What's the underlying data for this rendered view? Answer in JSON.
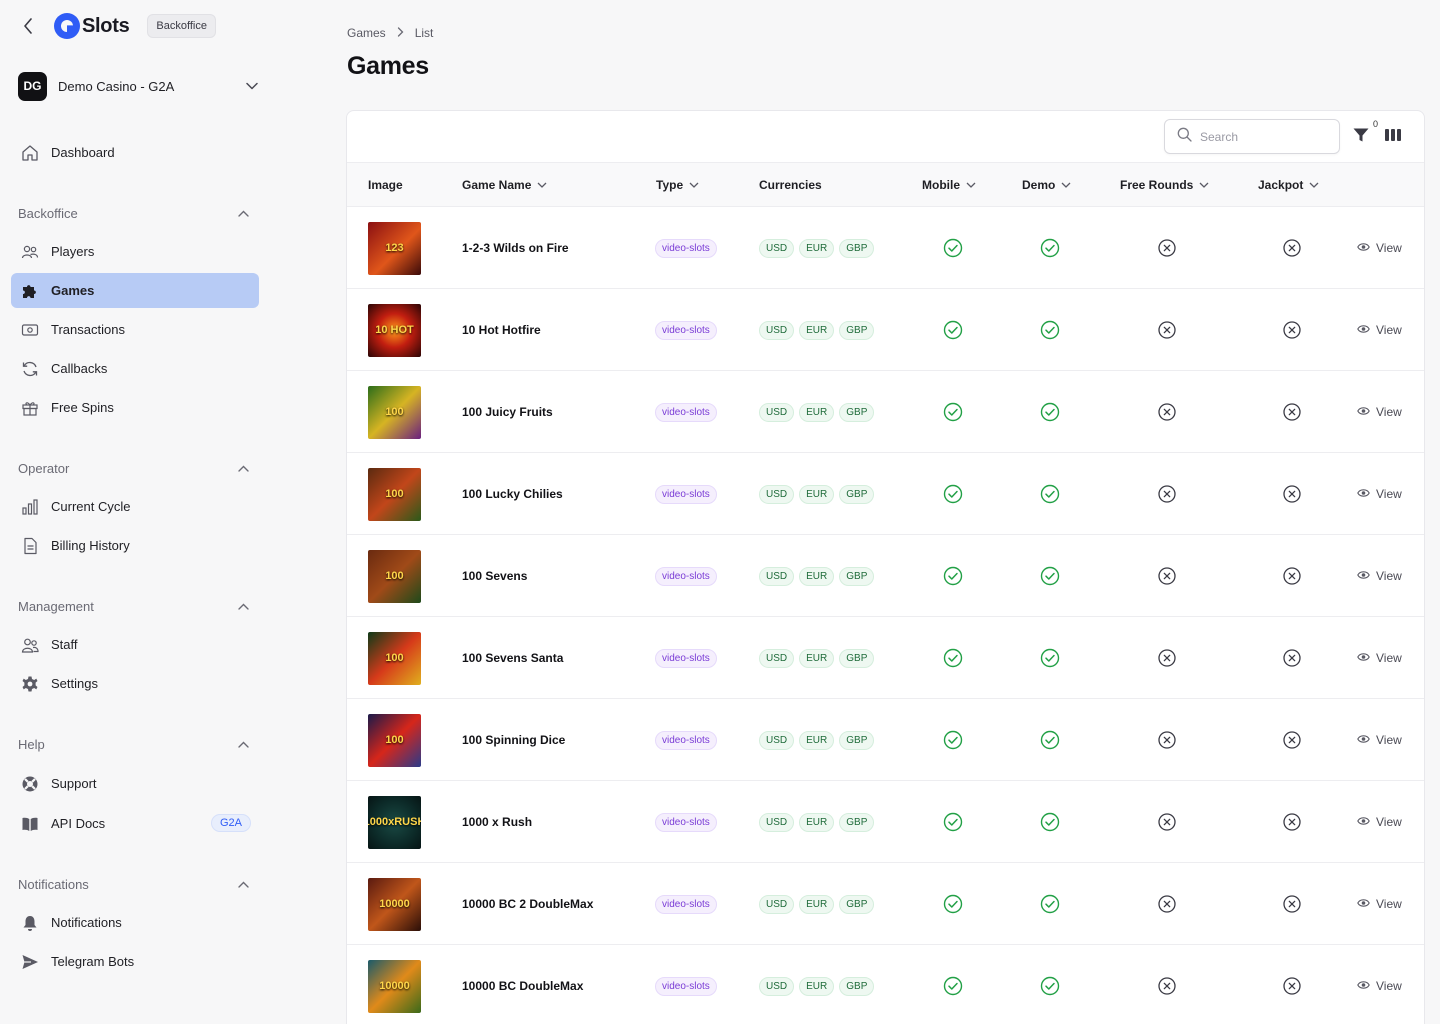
{
  "brand": {
    "name": "Slots",
    "badge": "Backoffice"
  },
  "casino": {
    "initials": "DG",
    "name": "Demo Casino - G2A"
  },
  "nav": {
    "dashboard": "Dashboard",
    "sections": [
      {
        "title": "Backoffice",
        "items": [
          "Players",
          "Games",
          "Transactions",
          "Callbacks",
          "Free Spins"
        ]
      },
      {
        "title": "Operator",
        "items": [
          "Current Cycle",
          "Billing History"
        ]
      },
      {
        "title": "Management",
        "items": [
          "Staff",
          "Settings"
        ]
      },
      {
        "title": "Help",
        "items": [
          "Support",
          "API Docs"
        ]
      },
      {
        "title": "Notifications",
        "items": [
          "Notifications",
          "Telegram Bots"
        ]
      }
    ],
    "active": "Games",
    "api_docs_tag": "G2A"
  },
  "breadcrumb": [
    "Games",
    "List"
  ],
  "page_title": "Games",
  "toolbar": {
    "search_placeholder": "Search",
    "filter_count": "0"
  },
  "table": {
    "columns": [
      "Image",
      "Game Name",
      "Type",
      "Currencies",
      "Mobile",
      "Demo",
      "Free Rounds",
      "Jackpot"
    ],
    "view_label": "View",
    "rows": [
      {
        "name": "1-2-3 Wilds on Fire",
        "thumb_text": "123",
        "type": "video-slots",
        "currencies": [
          "USD",
          "EUR",
          "GBP"
        ],
        "mobile": true,
        "demo": true,
        "free_rounds": false,
        "jackpot": false
      },
      {
        "name": "10 Hot Hotfire",
        "thumb_text": "10 HOT",
        "type": "video-slots",
        "currencies": [
          "USD",
          "EUR",
          "GBP"
        ],
        "mobile": true,
        "demo": true,
        "free_rounds": false,
        "jackpot": false
      },
      {
        "name": "100 Juicy Fruits",
        "thumb_text": "100",
        "type": "video-slots",
        "currencies": [
          "USD",
          "EUR",
          "GBP"
        ],
        "mobile": true,
        "demo": true,
        "free_rounds": false,
        "jackpot": false
      },
      {
        "name": "100 Lucky Chilies",
        "thumb_text": "100",
        "type": "video-slots",
        "currencies": [
          "USD",
          "EUR",
          "GBP"
        ],
        "mobile": true,
        "demo": true,
        "free_rounds": false,
        "jackpot": false
      },
      {
        "name": "100 Sevens",
        "thumb_text": "100",
        "type": "video-slots",
        "currencies": [
          "USD",
          "EUR",
          "GBP"
        ],
        "mobile": true,
        "demo": true,
        "free_rounds": false,
        "jackpot": false
      },
      {
        "name": "100 Sevens Santa",
        "thumb_text": "100",
        "type": "video-slots",
        "currencies": [
          "USD",
          "EUR",
          "GBP"
        ],
        "mobile": true,
        "demo": true,
        "free_rounds": false,
        "jackpot": false
      },
      {
        "name": "100 Spinning Dice",
        "thumb_text": "100",
        "type": "video-slots",
        "currencies": [
          "USD",
          "EUR",
          "GBP"
        ],
        "mobile": true,
        "demo": true,
        "free_rounds": false,
        "jackpot": false
      },
      {
        "name": "1000 x Rush",
        "thumb_text": "1000xRUSH",
        "type": "video-slots",
        "currencies": [
          "USD",
          "EUR",
          "GBP"
        ],
        "mobile": true,
        "demo": true,
        "free_rounds": false,
        "jackpot": false
      },
      {
        "name": "10000 BC 2 DoubleMax",
        "thumb_text": "10000",
        "type": "video-slots",
        "currencies": [
          "USD",
          "EUR",
          "GBP"
        ],
        "mobile": true,
        "demo": true,
        "free_rounds": false,
        "jackpot": false
      },
      {
        "name": "10000 BC DoubleMax",
        "thumb_text": "10000",
        "type": "video-slots",
        "currencies": [
          "USD",
          "EUR",
          "GBP"
        ],
        "mobile": true,
        "demo": true,
        "free_rounds": false,
        "jackpot": false
      }
    ]
  },
  "colors": {
    "accent": "#2f5cf6",
    "active_nav": "#b7cbf5",
    "check": "#22a046",
    "cross": "#3a3a44",
    "type_pill": "#7a3cd6"
  }
}
